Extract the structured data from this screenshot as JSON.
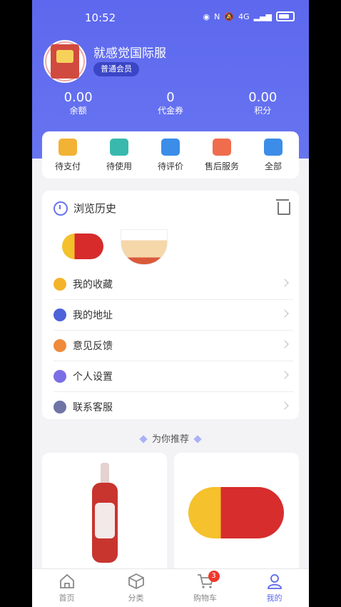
{
  "status_bar": {
    "time": "10:52",
    "network": "4G"
  },
  "profile": {
    "name": "就感觉国际服",
    "level": "普通会员"
  },
  "stats": [
    {
      "value": "0.00",
      "label": "余额"
    },
    {
      "value": "0",
      "label": "代金券"
    },
    {
      "value": "0.00",
      "label": "积分"
    }
  ],
  "orders": [
    {
      "label": "待支付",
      "icon": "wallet-icon",
      "color": "#f2b233"
    },
    {
      "label": "待使用",
      "icon": "card-icon",
      "color": "#39b9ad"
    },
    {
      "label": "待评价",
      "icon": "comment-icon",
      "color": "#3b8de8"
    },
    {
      "label": "售后服务",
      "icon": "after-sale-icon",
      "color": "#ef6d4d"
    },
    {
      "label": "全部",
      "icon": "clipboard-icon",
      "color": "#3b8de8"
    }
  ],
  "history": {
    "title": "浏览历史"
  },
  "menu": [
    {
      "label": "我的收藏",
      "icon": "star-icon",
      "color": "#f3b42c"
    },
    {
      "label": "我的地址",
      "icon": "location-icon",
      "color": "#4e62d9"
    },
    {
      "label": "意见反馈",
      "icon": "feedback-icon",
      "color": "#ef8a3a"
    },
    {
      "label": "个人设置",
      "icon": "settings-icon",
      "color": "#7a6fe5"
    },
    {
      "label": "联系客服",
      "icon": "headset-icon",
      "color": "#6e74a6"
    }
  ],
  "recommend": {
    "title": "为你推荐"
  },
  "tabs": [
    {
      "label": "首页",
      "icon": "home-icon"
    },
    {
      "label": "分类",
      "icon": "category-icon"
    },
    {
      "label": "购物车",
      "icon": "cart-icon",
      "badge": "3"
    },
    {
      "label": "我的",
      "icon": "user-icon"
    }
  ],
  "accent": "#5d68ee"
}
